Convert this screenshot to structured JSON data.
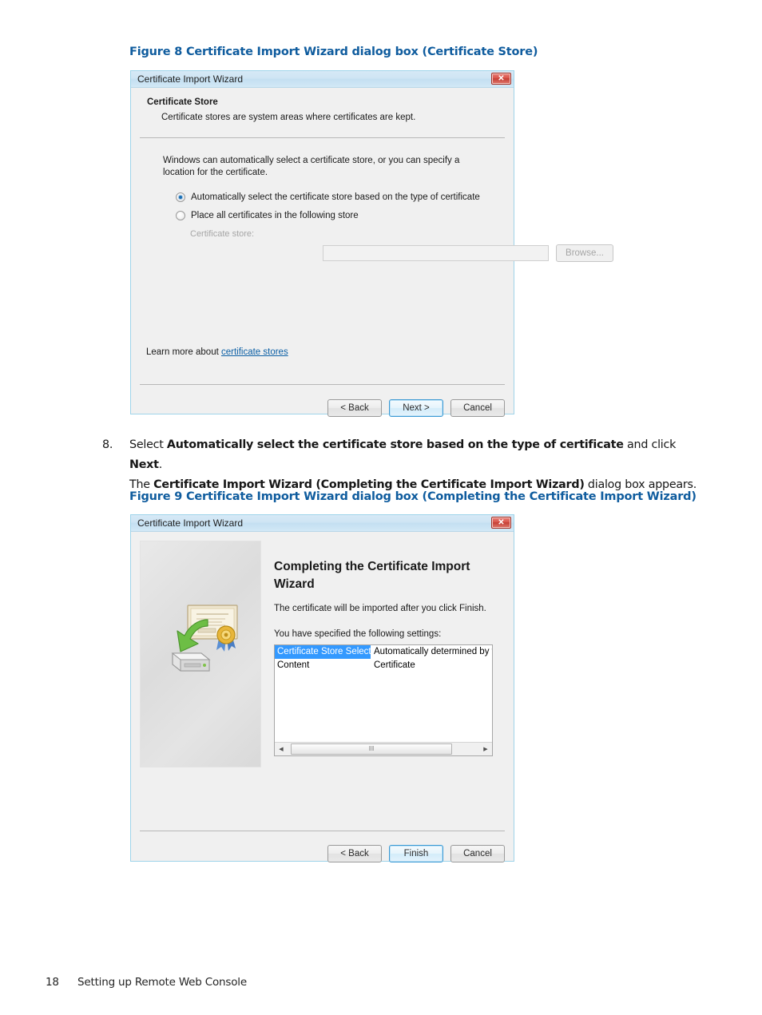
{
  "figures": {
    "fig8_caption": "Figure 8 Certificate Import Wizard dialog box (Certificate Store)",
    "fig9_caption": "Figure 9 Certificate Import Wizard dialog box (Completing the Certificate Import Wizard)"
  },
  "step": {
    "number": "8.",
    "line1_pre": "Select ",
    "line1_bold": "Automatically select the certificate store based on the type of certificate",
    "line1_mid": " and click ",
    "line1_bold2": "Next",
    "line1_post": ".",
    "line2_pre": "The ",
    "line2_bold": "Certificate Import Wizard (Completing the Certificate Import Wizard)",
    "line2_post": " dialog box appears."
  },
  "dialog_store": {
    "title": "Certificate Import Wizard",
    "close_glyph": "✕",
    "header_title": "Certificate Store",
    "header_sub": "Certificate stores are system areas where certificates are kept.",
    "intro": "Windows can automatically select a certificate store, or you can specify a location for the certificate.",
    "radio_auto_label": "Automatically select the certificate store based on the type of certificate",
    "radio_auto_checked": true,
    "radio_manual_label": "Place all certificates in the following store",
    "radio_manual_checked": false,
    "store_field_label": "Certificate store:",
    "store_field_value": "",
    "browse_label": "Browse...",
    "learn_more_prefix": "Learn more about ",
    "learn_more_link": "certificate stores",
    "buttons": {
      "back": "< Back",
      "next": "Next >",
      "cancel": "Cancel"
    }
  },
  "dialog_finish": {
    "title": "Certificate Import Wizard",
    "close_glyph": "✕",
    "heading": "Completing the Certificate Import Wizard",
    "line1": "The certificate will be imported after you click Finish.",
    "line2": "You have specified the following settings:",
    "settings": [
      {
        "key": "Certificate Store Selected",
        "value": "Automatically determined by t",
        "selected": true
      },
      {
        "key": "Content",
        "value": "Certificate",
        "selected": false
      }
    ],
    "scroll_left_glyph": "◀",
    "scroll_right_glyph": "▶",
    "scroll_grip": "‖‖",
    "buttons": {
      "back": "< Back",
      "finish": "Finish",
      "cancel": "Cancel"
    }
  },
  "footer": {
    "page_number": "18",
    "section": "Setting up Remote Web Console"
  },
  "colors": {
    "caption_blue": "#0f5c9e",
    "link_blue": "#0b5fa5",
    "selection_blue": "#3399ff",
    "dialog_bg": "#f0f0f0",
    "close_red": "#c43f35"
  }
}
